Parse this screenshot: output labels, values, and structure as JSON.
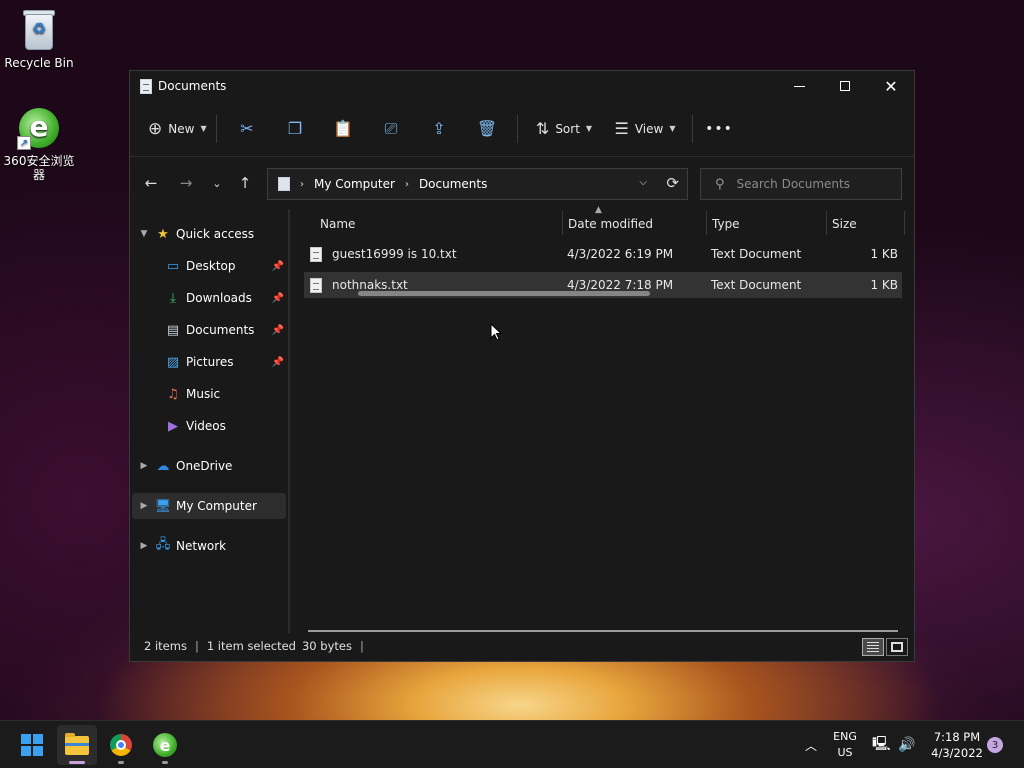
{
  "desktop": {
    "icons": [
      {
        "label": "Recycle Bin",
        "icon": "recycle-bin-icon"
      },
      {
        "label": "360安全浏览器",
        "icon": "360-browser-icon"
      }
    ]
  },
  "window": {
    "title": "Documents",
    "controls": {
      "minimize": "minimize",
      "maximize": "maximize",
      "close": "close"
    }
  },
  "toolbar": {
    "new_label": "New",
    "sort_label": "Sort",
    "view_label": "View",
    "more_label": "•••",
    "icons": [
      "cut-icon",
      "copy-icon",
      "paste-icon",
      "rename-icon",
      "share-icon",
      "delete-icon"
    ]
  },
  "address": {
    "crumbs": [
      "My Computer",
      "Documents"
    ],
    "search_placeholder": "Search Documents"
  },
  "navpane": {
    "quick_access": "Quick access",
    "items": [
      {
        "label": "Desktop",
        "pinned": true
      },
      {
        "label": "Downloads",
        "pinned": true
      },
      {
        "label": "Documents",
        "pinned": true
      },
      {
        "label": "Pictures",
        "pinned": true
      },
      {
        "label": "Music",
        "pinned": false
      },
      {
        "label": "Videos",
        "pinned": false
      }
    ],
    "onedrive": "OneDrive",
    "my_computer": "My Computer",
    "network": "Network"
  },
  "files": {
    "columns": {
      "name": "Name",
      "date": "Date modified",
      "type": "Type",
      "size": "Size"
    },
    "rows": [
      {
        "name": "guest16999 is 10.txt",
        "date": "4/3/2022 6:19 PM",
        "type": "Text Document",
        "size": "1 KB",
        "selected": false
      },
      {
        "name": "nothnaks.txt",
        "date": "4/3/2022 7:18 PM",
        "type": "Text Document",
        "size": "1 KB",
        "selected": true
      }
    ]
  },
  "status": {
    "items": "2 items",
    "selected": "1 item selected",
    "bytes": "30 bytes"
  },
  "taskbar": {
    "apps": [
      "start",
      "file-explorer",
      "chrome",
      "360-browser"
    ],
    "lang_line1": "ENG",
    "lang_line2": "US",
    "time": "7:18 PM",
    "date": "4/3/2022",
    "notifications": "3"
  },
  "colors": {
    "accent": "#7fb8f0",
    "window_bg": "#191919",
    "selected_row": "#333333"
  }
}
